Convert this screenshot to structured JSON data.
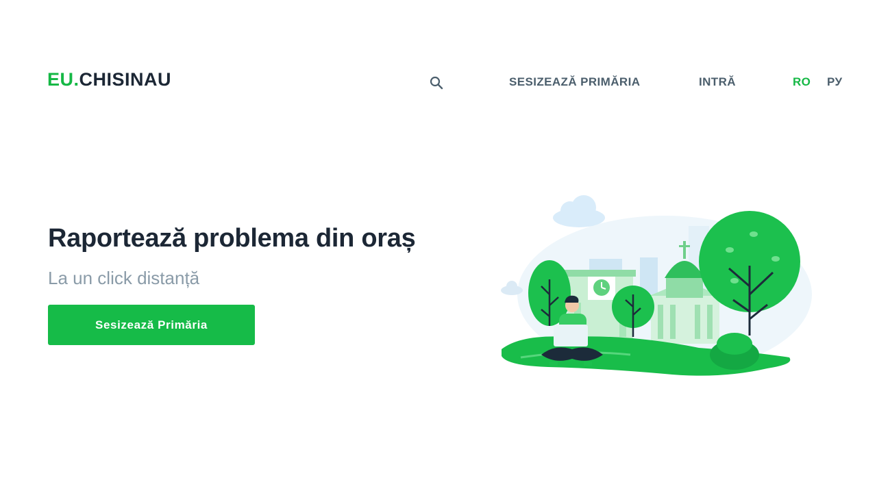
{
  "header": {
    "logo": {
      "prefix": "EU.",
      "suffix": "CHISINAU"
    },
    "nav": {
      "search_icon": "search-icon",
      "report_label": "SESIZEAZĂ PRIMĂRIA",
      "login_label": "INTRĂ",
      "lang_ro": "RO",
      "lang_ru": "РУ",
      "active_lang": "RO"
    }
  },
  "hero": {
    "title": "Raportează problema din oraș",
    "subtitle": "La un click distanță",
    "cta_label": "Sesizează Primăria"
  },
  "colors": {
    "accent": "#15b845",
    "button": "#16bb48",
    "text_dark": "#1c2735",
    "text_muted": "#8a9ba8",
    "nav_text": "#4b5e6c"
  }
}
